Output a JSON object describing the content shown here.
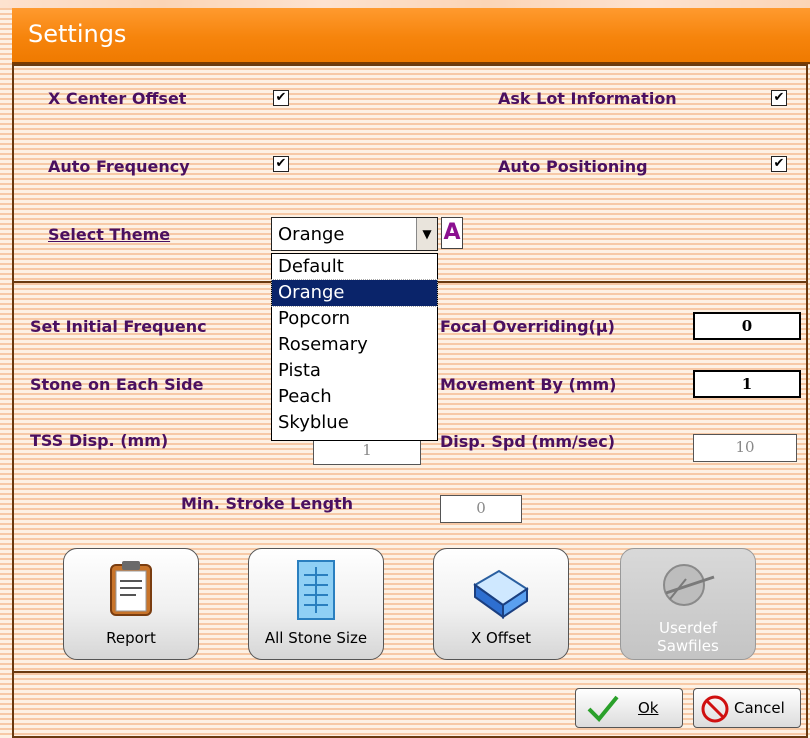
{
  "window": {
    "title": "Settings"
  },
  "options": {
    "x_center_offset": {
      "label": "X Center Offset",
      "checked": true
    },
    "ask_lot_information": {
      "label": "Ask Lot Information",
      "checked": true
    },
    "auto_frequency": {
      "label": "Auto Frequency",
      "checked": true
    },
    "auto_positioning": {
      "label": "Auto Positioning",
      "checked": true
    }
  },
  "theme": {
    "label": "Select Theme",
    "selected": "Orange",
    "font_button": "A",
    "options": [
      "Default",
      "Orange",
      "Popcorn",
      "Rosemary",
      "Pista",
      "Peach",
      "Skyblue"
    ]
  },
  "params": {
    "set_initial_frequency": {
      "label": "Set Initial Frequenc"
    },
    "stone_on_each_side": {
      "label": "Stone on Each Side"
    },
    "tss_disp": {
      "label": "TSS Disp. (mm)",
      "value": "1"
    },
    "focal_overriding": {
      "label": "Focal Overriding(μ)",
      "value": "0"
    },
    "movement_by": {
      "label": "Movement By (mm)",
      "value": "1"
    },
    "disp_spd": {
      "label": "Disp. Spd (mm/sec)",
      "value": "10"
    },
    "min_stroke_length": {
      "label": "Min. Stroke Length",
      "value": "0"
    }
  },
  "actions": {
    "report": "Report",
    "all_stone_size": "All Stone Size",
    "x_offset": "X Offset",
    "userdef_1": "Userdef",
    "userdef_2": "Sawfiles"
  },
  "footer": {
    "ok": "Ok",
    "cancel": "Cancel"
  }
}
